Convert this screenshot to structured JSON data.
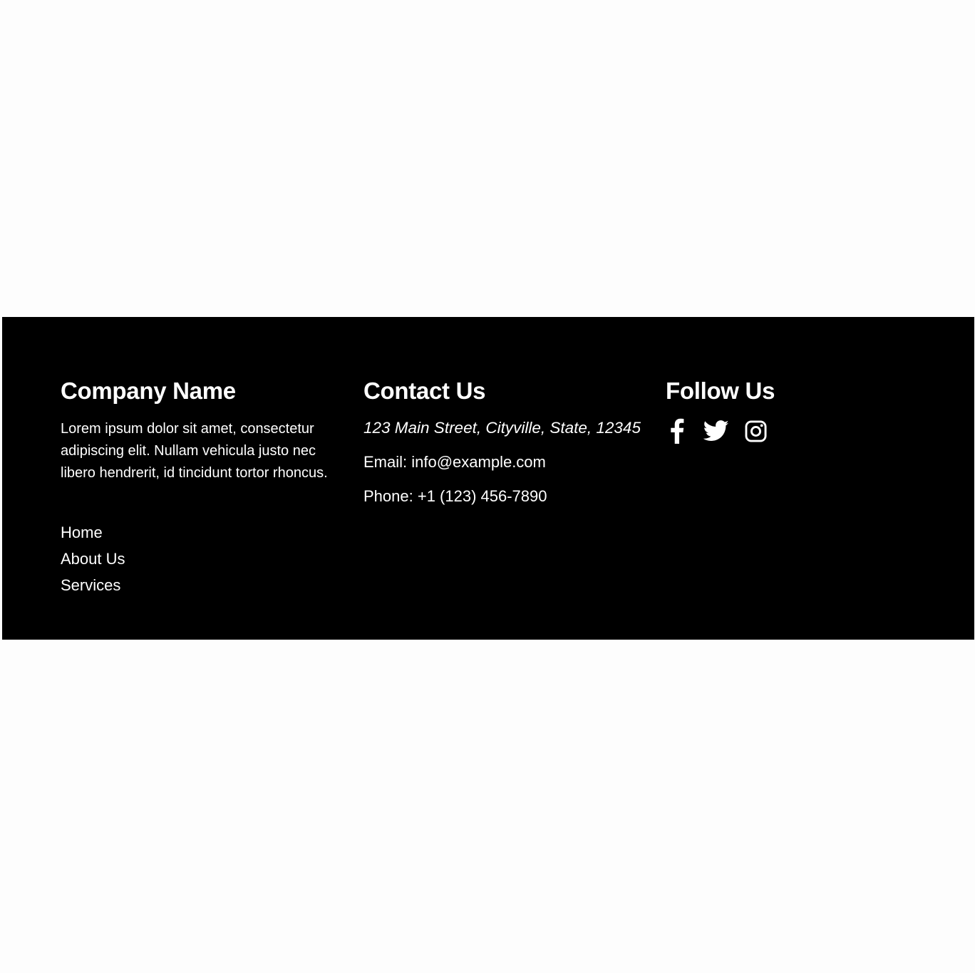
{
  "footer": {
    "company": {
      "title": "Company Name",
      "description": "Lorem ipsum dolor sit amet, consectetur adipiscing elit. Nullam vehicula justo nec libero hendrerit, id tincidunt tortor rhoncus.",
      "links": [
        {
          "label": "Home"
        },
        {
          "label": "About Us"
        },
        {
          "label": "Services"
        }
      ]
    },
    "contact": {
      "title": "Contact Us",
      "address": "123 Main Street, Cityville, State, 12345",
      "email": "Email: info@example.com",
      "phone": "Phone: +1 (123) 456-7890"
    },
    "follow": {
      "title": "Follow Us",
      "icons": [
        "facebook-icon",
        "twitter-icon",
        "instagram-icon"
      ]
    }
  },
  "colors": {
    "page_background": "#fdfdfd",
    "footer_background": "#000000",
    "footer_text": "#ffffff"
  }
}
